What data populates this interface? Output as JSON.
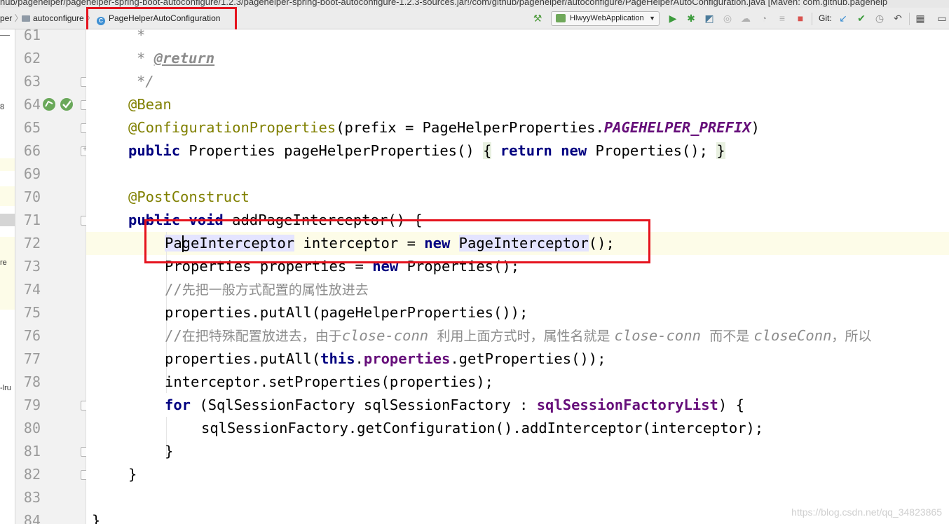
{
  "window": {
    "title": "hub/pagehelper/pagehelper-spring-boot-autoconfigure/1.2.3/pagehelper-spring-boot-autoconfigure-1.2.3-sources.jar!/com/github/pagehelper/autoconfigure/PageHelperAutoConfiguration.java [Maven: com.github.pagehelp"
  },
  "breadcrumbs": [
    {
      "label": "per",
      "icon": "none"
    },
    {
      "label": "autoconfigure",
      "icon": "folder-icon"
    },
    {
      "label": "PageHelperAutoConfiguration",
      "icon": "class-icon"
    }
  ],
  "toolbar": {
    "run_config_label": "HlwyyWebApplication",
    "git_label": "Git:",
    "icons": [
      "build-hammer-icon",
      "run-icon",
      "debug-icon",
      "coverage-icon",
      "profile-icon",
      "attach-icon",
      "update-icon",
      "stop-icon",
      "vcs-update-icon",
      "vcs-commit-icon",
      "history-icon",
      "revert-icon",
      "project-structure-icon",
      "layout-icon"
    ],
    "colors": {
      "run": "#3c9b3c",
      "stop": "#d9534f",
      "accent": "#3d8fd3"
    }
  },
  "left_panel": {
    "fragments": [
      "8",
      "re",
      "-lru"
    ]
  },
  "gutter": {
    "line_numbers": [
      "61",
      "62",
      "63",
      "64",
      "65",
      "66",
      "69",
      "70",
      "71",
      "72",
      "73",
      "74",
      "75",
      "76",
      "77",
      "78",
      "79",
      "80",
      "81",
      "82",
      "83",
      "84"
    ]
  },
  "code": {
    "l61": "*",
    "l62_star": "* ",
    "l62_tag": "@return",
    "l63": "*/",
    "l64": "@Bean",
    "l65_annot": "@ConfigurationProperties",
    "l65_mid": "(prefix = PageHelperProperties.",
    "l65_const": "PAGEHELPER_PREFIX",
    "l65_end": ")",
    "l66_kw": "public",
    "l66_mid": " Properties pageHelperProperties() ",
    "l66_open": "{",
    "l66_ret": "return",
    "l66_sp": " ",
    "l66_new": "new",
    "l66_tail": " Properties(); ",
    "l66_close": "}",
    "l70": "@PostConstruct",
    "l71_kw1": "public",
    "l71_kw2": "void",
    "l71_rest": " addPageInterceptor() {",
    "l72_type": "PageInterceptor",
    "l72_mid": " interceptor = ",
    "l72_new": "new",
    "l72_sp": " ",
    "l72_type2": "PageInterceptor",
    "l72_end": "();",
    "l73_a": "Properties properties = ",
    "l73_new": "new",
    "l73_b": " Properties();",
    "l74_slash": "//",
    "l74_cn": "先把一般方式配置的属性放进去",
    "l75": "properties.putAll(pageHelperProperties());",
    "l76_slash": "//",
    "l76_cn1": "在把特殊配置放进去，由于",
    "l76_it1": "close-conn ",
    "l76_cn2": "利用上面方式时，属性名就是 ",
    "l76_it2": "close-conn ",
    "l76_cn3": "而不是 ",
    "l76_it3": "closeConn",
    "l76_cn4": "，所以",
    "l77_a": "properties.putAll(",
    "l77_this": "this",
    "l77_dot": ".",
    "l77_field": "properties",
    "l77_b": ".getProperties());",
    "l78": "interceptor.setProperties(properties);",
    "l79_for": "for",
    "l79_a": " (SqlSessionFactory sqlSessionFactory : ",
    "l79_field": "sqlSessionFactoryList",
    "l79_b": ") {",
    "l80": "sqlSessionFactory.getConfiguration().addInterceptor(interceptor);",
    "l81": "}",
    "l82": "}",
    "l84": "}"
  },
  "watermark": "https://blog.csdn.net/qq_34823865",
  "highlight_color": "#e5131e"
}
